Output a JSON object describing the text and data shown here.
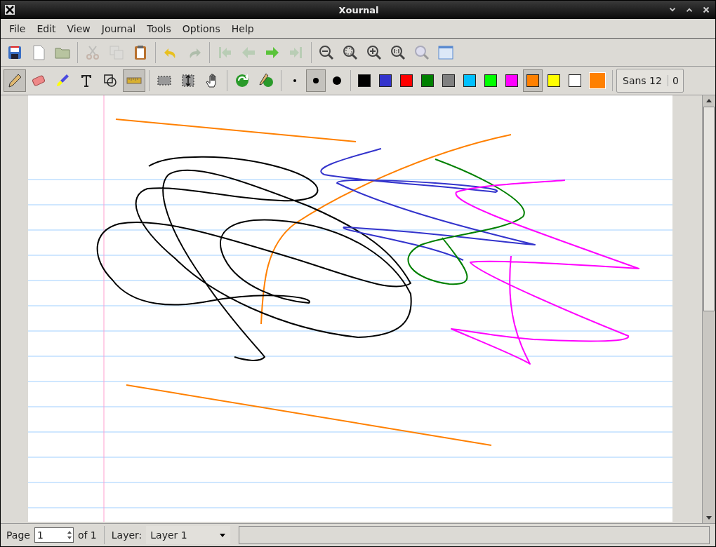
{
  "window": {
    "title": "Xournal"
  },
  "menu": [
    "File",
    "Edit",
    "View",
    "Journal",
    "Tools",
    "Options",
    "Help"
  ],
  "main_toolbar": {
    "groups": [
      {
        "buttons": [
          {
            "disabled": false
          },
          {
            "disabled": false
          },
          {
            "disabled": false
          }
        ]
      },
      {
        "buttons": [
          {
            "disabled": true
          },
          {
            "disabled": true
          },
          {
            "disabled": false
          }
        ]
      },
      {
        "buttons": [
          {
            "disabled": false
          },
          {
            "disabled": true
          }
        ]
      },
      {
        "buttons": [
          {
            "disabled": true
          },
          {
            "disabled": true
          },
          {
            "disabled": false
          },
          {
            "disabled": true
          }
        ]
      },
      {
        "buttons": [
          {
            "disabled": false
          },
          {
            "disabled": false
          },
          {
            "disabled": false
          },
          {
            "disabled": false
          },
          {
            "disabled": false
          },
          {
            "disabled": false
          }
        ]
      }
    ]
  },
  "tools": [
    {
      "selected": true
    },
    {
      "selected": false
    },
    {
      "selected": false
    },
    {
      "selected": false
    },
    {
      "selected": false
    },
    {
      "selected": true
    }
  ],
  "selection_tools": [
    {
      "selected": false
    },
    {
      "selected": false
    },
    {
      "selected": false
    }
  ],
  "thickness": [
    {
      "selected": false
    },
    {
      "selected": true
    },
    {
      "selected": false
    }
  ],
  "colors": [
    {
      "color": "#000000",
      "selected": false
    },
    {
      "color": "#3333cc",
      "selected": false
    },
    {
      "color": "#ff0000",
      "selected": false
    },
    {
      "color": "#008000",
      "selected": false
    },
    {
      "color": "#808080",
      "selected": false
    },
    {
      "color": "#00c0ff",
      "selected": false
    },
    {
      "color": "#00ff00",
      "selected": false
    },
    {
      "color": "#ff00ff",
      "selected": false
    },
    {
      "color": "#ff8000",
      "selected": true
    },
    {
      "color": "#ffff00",
      "selected": false
    },
    {
      "color": "#ffffff",
      "selected": false
    }
  ],
  "current_color": {
    "color": "#ff8000"
  },
  "font_button": {
    "label": "Sans 12",
    "size": "0"
  },
  "status_bar": {
    "page_label": "Page",
    "page_value": "1",
    "page_total": "of 1",
    "layer_label": "Layer:",
    "layer_value": "Layer 1"
  }
}
